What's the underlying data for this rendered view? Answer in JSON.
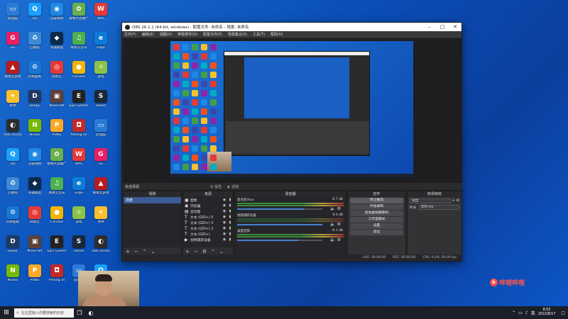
{
  "desktop_icons": [
    {
      "label": "此电脑",
      "color": "#2b7bd6",
      "glyph": "▭"
    },
    {
      "label": "QQ",
      "color": "#1aa0ff",
      "glyph": "Q"
    },
    {
      "label": "迅雷视频",
      "color": "#1e88e5",
      "glyph": "◉"
    },
    {
      "label": "植物大战僵尸",
      "color": "#6ab04c",
      "glyph": "✿"
    },
    {
      "label": "WPS",
      "color": "#e53935",
      "glyph": "W"
    },
    {
      "label": "GG",
      "color": "#e91e63",
      "glyph": "G"
    },
    {
      "label": "回收站",
      "color": "#3f8ad6",
      "glyph": "♻"
    },
    {
      "label": "英雄联盟",
      "color": "#0c2a4a",
      "glyph": "◆"
    },
    {
      "label": "网易云音乐",
      "color": "#4caf50",
      "glyph": "♫"
    },
    {
      "label": "Edge",
      "color": "#0b7dd8",
      "glyph": "e"
    },
    {
      "label": "网易云游戏",
      "color": "#b71c1c",
      "glyph": "▲"
    },
    {
      "label": "控制面板",
      "color": "#1976d2",
      "glyph": "⚙"
    },
    {
      "label": "网易云",
      "color": "#e53935",
      "glyph": "◎"
    },
    {
      "label": "Chrome",
      "color": "#f4b400",
      "glyph": "●"
    },
    {
      "label": "游戏",
      "color": "#8bc34a",
      "glyph": "☼"
    },
    {
      "label": "原神",
      "color": "#fbc02d",
      "glyph": "✦"
    },
    {
      "label": "DeepL",
      "color": "#1e3a5f",
      "glyph": "D"
    },
    {
      "label": "Minecraft",
      "color": "#5d4037",
      "glyph": "▣"
    },
    {
      "label": "Epic Games",
      "color": "#222222",
      "glyph": "E"
    },
    {
      "label": "Steam",
      "color": "#1b2838",
      "glyph": "S"
    },
    {
      "label": "OBS Studio",
      "color": "#2d2d2d",
      "glyph": "◐"
    },
    {
      "label": "Nvidia",
      "color": "#76b900",
      "glyph": "N"
    },
    {
      "label": "PUBG",
      "color": "#f9a825",
      "glyph": "P"
    },
    {
      "label": "Among Us",
      "color": "#c62828",
      "glyph": "◘"
    }
  ],
  "obs": {
    "title": "OBS 26.1.1 (64-bit, windows) - 配置文件: 未命名 - 场景: 未命名",
    "menu": [
      "文件(F)",
      "编辑(E)",
      "视图(V)",
      "停靠部件(D)",
      "配置文件(P)",
      "场景集合(S)",
      "工具(T)",
      "帮助(H)"
    ],
    "no_source": "未选择源",
    "props_label": "属性",
    "filters_label": "滤镜",
    "docks": {
      "scenes": "场景",
      "sources": "来源",
      "mixer": "混音器",
      "controls": "控件",
      "transitions": "转场特效"
    },
    "scene_items": [
      "场景"
    ],
    "sources": [
      {
        "icon": "▣",
        "name": "图像"
      },
      {
        "icon": "◉",
        "name": "浏览器"
      },
      {
        "icon": "▤",
        "name": "自动图"
      },
      {
        "icon": "T",
        "name": "文本 (GDI+) 5"
      },
      {
        "icon": "T",
        "name": "文本 (GDI+) 3"
      },
      {
        "icon": "T",
        "name": "文本 (GDI+) 2"
      },
      {
        "icon": "T",
        "name": "文本 (GDI+)"
      },
      {
        "icon": "▶",
        "name": "视频捕获设备"
      }
    ],
    "mixer": [
      {
        "name": "麦克风/Aux",
        "db": "-6.7 dB",
        "level": 0.78
      },
      {
        "name": "视频捕获设备",
        "db": "0.0 dB",
        "level": 0.0
      },
      {
        "name": "桌面音频",
        "db": "-9.1 dB",
        "level": 0.72
      }
    ],
    "controls": [
      "停止推流",
      "开始录制",
      "启动虚拟摄像机",
      "工作室模式",
      "设置",
      "退出"
    ],
    "transition": {
      "value": "淡出",
      "duration_label": "时长",
      "duration": "300 ms"
    },
    "status": {
      "live": "LIVE: 00:00:00",
      "rec": "REC: 00:00:00",
      "cpu": "CPU: 0.0%, 60.00 fps"
    }
  },
  "watermark": "哔哩哔哩",
  "taskbar": {
    "search_placeholder": "在这里输入你要搜索的内容",
    "time": "8:55",
    "date": "2022/8/17",
    "lang": "英"
  }
}
